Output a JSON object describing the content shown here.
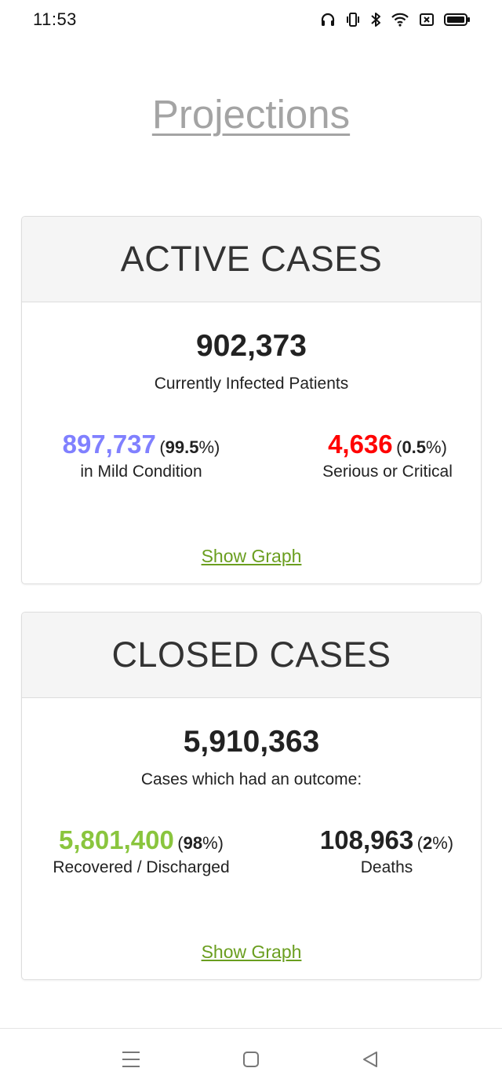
{
  "status_bar": {
    "time": "11:53",
    "icons": [
      "headphones-icon",
      "vibrate-icon",
      "bluetooth-icon",
      "wifi-icon",
      "no-sim-icon",
      "battery-icon"
    ]
  },
  "page": {
    "title": "Projections"
  },
  "active_cases": {
    "header": "ACTIVE CASES",
    "total": "902,373",
    "total_label": "Currently Infected Patients",
    "mild": {
      "value": "897,737",
      "pct_open": "(",
      "pct_value": "99.5",
      "pct_close": "%)",
      "label": "in Mild Condition",
      "color": "#8080ff"
    },
    "serious": {
      "value": "4,636",
      "pct_open": "(",
      "pct_value": "0.5",
      "pct_close": "%)",
      "label": "Serious or Critical",
      "color": "#ff0000"
    },
    "show_graph": "Show Graph"
  },
  "closed_cases": {
    "header": "CLOSED CASES",
    "total": "5,910,363",
    "total_label": "Cases which had an outcome:",
    "recovered": {
      "value": "5,801,400",
      "pct_open": "(",
      "pct_value": "98",
      "pct_close": "%)",
      "label": "Recovered / Discharged",
      "color": "#8ac53e"
    },
    "deaths": {
      "value": "108,963",
      "pct_open": "(",
      "pct_value": "2",
      "pct_close": "%)",
      "label": "Deaths",
      "color": "#222222"
    },
    "show_graph": "Show Graph"
  },
  "nav_bar": {
    "icons": [
      "menu-icon",
      "home-icon",
      "back-icon"
    ]
  },
  "colors": {
    "link": "#6a9e1f",
    "title": "#a4a4a4",
    "card_header_bg": "#f5f5f5"
  }
}
